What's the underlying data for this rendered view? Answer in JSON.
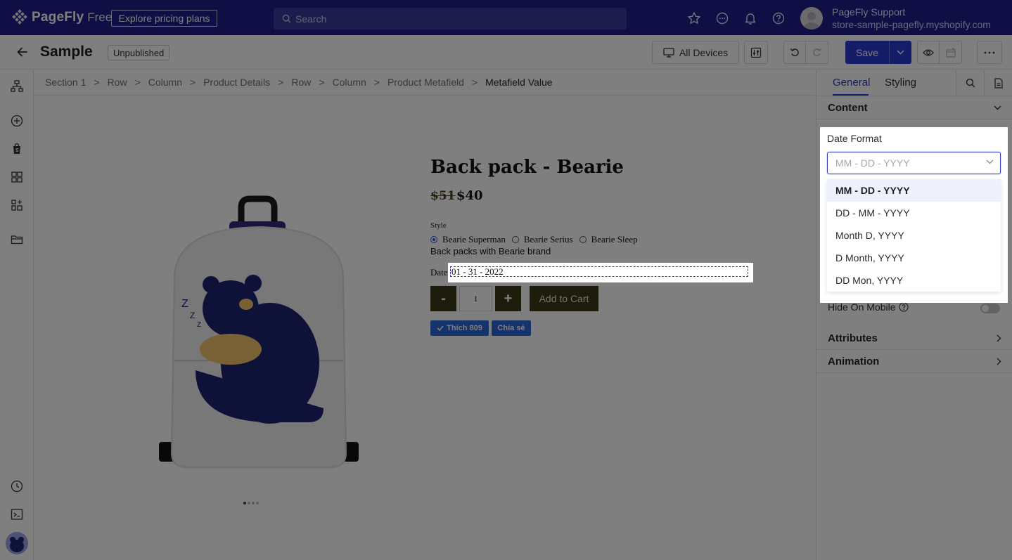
{
  "topbar": {
    "brand": "PageFly",
    "plan": "Free",
    "pricing_button": "Explore pricing plans",
    "search_placeholder": "Search",
    "user_name": "PageFly Support",
    "store": "store-sample-pagefly.myshopify.com"
  },
  "header": {
    "title": "Sample",
    "status": "Unpublished",
    "devices_button": "All Devices",
    "save_button": "Save"
  },
  "breadcrumb": [
    "Section 1",
    "Row",
    "Column",
    "Product Details",
    "Row",
    "Column",
    "Product Metafield",
    "Metafield Value"
  ],
  "product": {
    "title": "Back pack - Bearie",
    "price_old": "$51",
    "price_new": "$40",
    "style_label": "Style",
    "options": [
      {
        "label": "Bearie Superman",
        "selected": true
      },
      {
        "label": "Bearie Serius",
        "selected": false
      },
      {
        "label": "Bearie Sleep",
        "selected": false
      }
    ],
    "description": "Back packs with Bearie brand",
    "date_label": "Date",
    "date_value": "01 - 31 - 2022",
    "qty_minus": "-",
    "qty_value": "1",
    "qty_plus": "+",
    "add_to_cart": "Add to Cart",
    "like_label": "Thích 809",
    "share_label": "Chia sẻ"
  },
  "panel": {
    "tabs": [
      "General",
      "Styling"
    ],
    "active_tab": "General",
    "content_section": "Content",
    "date_format_label": "Date Format",
    "date_format_value": "MM - DD - YYYY",
    "date_format_options": [
      "MM - DD - YYYY",
      "DD - MM - YYYY",
      "Month D, YYYY",
      "D Month, YYYY",
      "DD Mon, YYYY"
    ],
    "hide_on_mobile": "Hide On Mobile",
    "attributes_section": "Attributes",
    "animation_section": "Animation"
  },
  "colors": {
    "topbar": "#1f1f8a",
    "accent": "#2b3bd3",
    "cart_button": "#3d3a17",
    "facebook": "#2a66d8"
  }
}
